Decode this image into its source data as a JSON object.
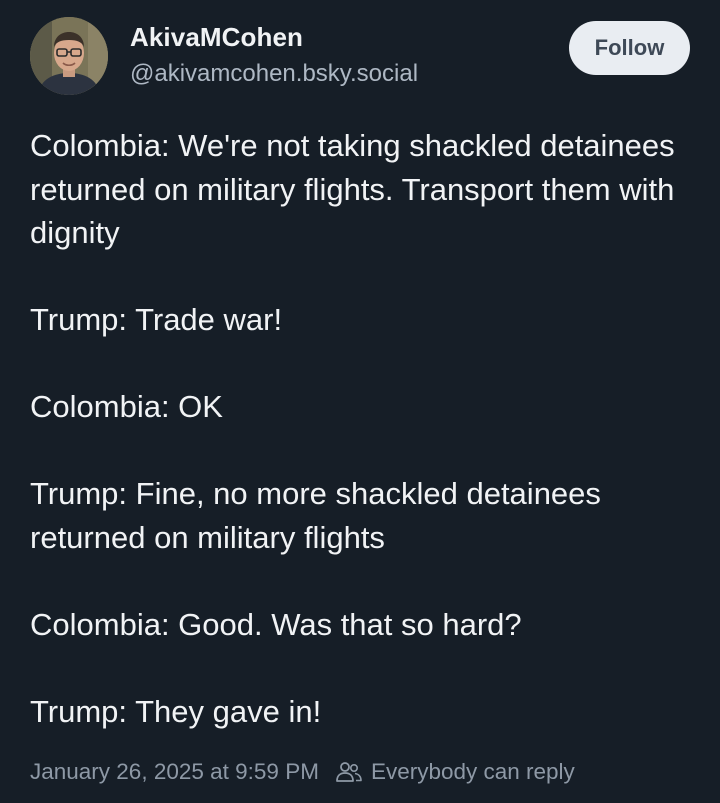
{
  "author": {
    "display_name": "AkivaMCohen",
    "handle": "@akivamcohen.bsky.social",
    "avatar_icon": "person-avatar-photo"
  },
  "follow_button": {
    "label": "Follow"
  },
  "post": {
    "lines": [
      "Colombia: We're not taking shackled detainees returned on military flights. Transport them with dignity",
      "Trump: Trade war!",
      "Colombia: OK",
      "Trump: Fine, no more shackled detainees returned on military flights",
      "Colombia: Good. Was that so hard?",
      "Trump: They gave in!"
    ]
  },
  "meta": {
    "timestamp": "January 26, 2025 at 9:59 PM",
    "reply_setting_icon": "people-icon",
    "reply_setting": "Everybody can reply"
  },
  "colors": {
    "background": "#161e27",
    "text": "#f1f3f5",
    "handle": "#aeb8c4",
    "meta": "#8e99a6",
    "follow_button_bg": "#e9edf2",
    "follow_button_text": "#3e4957"
  }
}
